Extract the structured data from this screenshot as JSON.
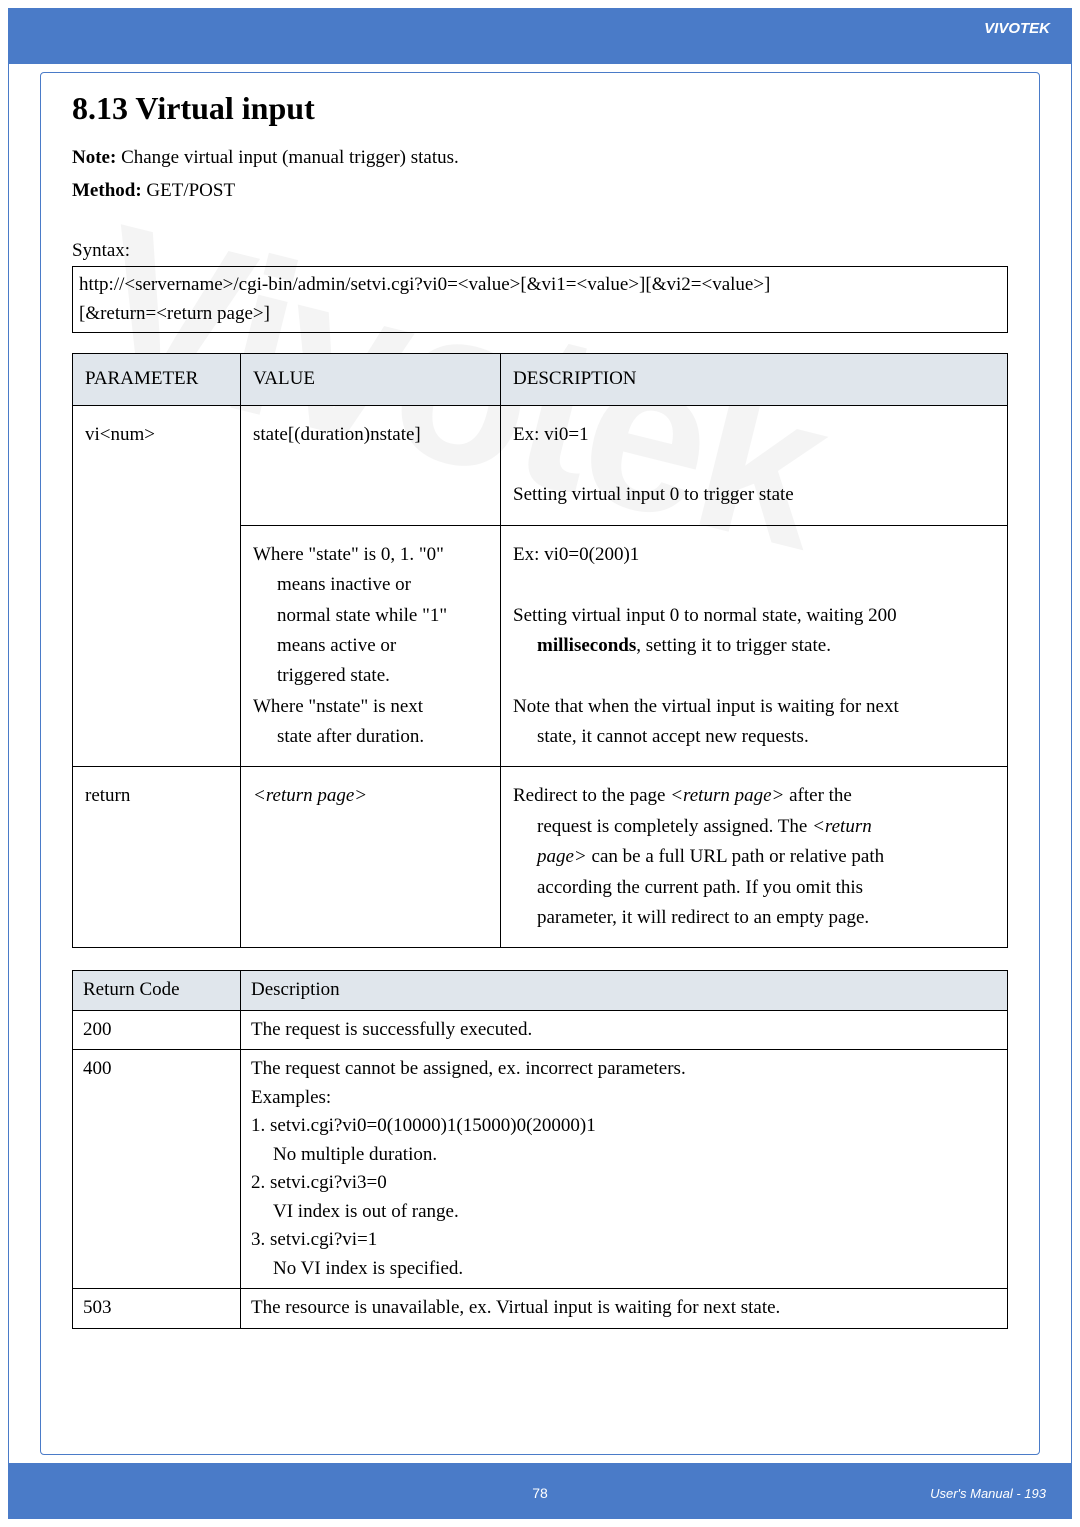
{
  "brand": "VIVOTEK",
  "watermark": "Vivotek",
  "heading": "8.13 Virtual input",
  "note_label": "Note:",
  "note_text": " Change virtual input (manual trigger) status.",
  "method_label": "Method:",
  "method_text": " GET/POST",
  "syntax_label": "Syntax:",
  "syntax_line1": "http://<servername>/cgi-bin/admin/setvi.cgi?vi0=<value>[&vi1=<value>][&vi2=<value>]",
  "syntax_line2": "[&return=<return page>]",
  "param_headers": {
    "c1": "PARAMETER",
    "c2": "VALUE",
    "c3": "DESCRIPTION"
  },
  "rows": {
    "r1": {
      "param": "vi<num>",
      "value": "state[(duration)nstate]",
      "desc1": "Ex: vi0=1",
      "desc2": "Setting virtual input 0 to trigger state"
    },
    "r2": {
      "v1": "Where \"state\" is 0, 1. \"0\"",
      "v2": "means inactive or",
      "v3": "normal state while \"1\"",
      "v4": "means active or",
      "v5": "triggered state.",
      "v6": "Where \"nstate\" is next",
      "v7": "state after duration.",
      "d1": "Ex: vi0=0(200)1",
      "d2": "Setting virtual input 0 to normal state, waiting 200 ",
      "d2b": "milliseconds",
      "d2c": ", setting it to trigger state.",
      "d3": "Note that when the virtual input is waiting for next",
      "d3b": "state, it cannot accept new requests."
    },
    "r3": {
      "param": "return",
      "value": "<return page>",
      "d1a": "Redirect to the page ",
      "d1b": "<return page>",
      "d1c": " after the",
      "d2a": "request is completely assigned. The ",
      "d2b": "<return",
      "d3a": "page>",
      "d3b": " can be a full URL path or relative path",
      "d4": "according the current path. If you omit this",
      "d5": "parameter, it will redirect to an empty page."
    }
  },
  "ret_headers": {
    "c1": "Return Code",
    "c2": "Description"
  },
  "ret": {
    "200": {
      "code": "200",
      "desc": "The request is successfully executed."
    },
    "400": {
      "code": "400",
      "l1": "The request cannot be assigned, ex. incorrect parameters.",
      "l2": "Examples:",
      "l3": "1. setvi.cgi?vi0=0(10000)1(15000)0(20000)1",
      "l3b": "No multiple duration.",
      "l4": "2. setvi.cgi?vi3=0",
      "l4b": "VI index is out of range.",
      "l5": "3. setvi.cgi?vi=1",
      "l5b": "No VI index is specified."
    },
    "503": {
      "code": "503",
      "desc": "The resource is unavailable, ex. Virtual input is waiting for next state."
    }
  },
  "page_num": "78",
  "manual": "User's Manual - 193"
}
